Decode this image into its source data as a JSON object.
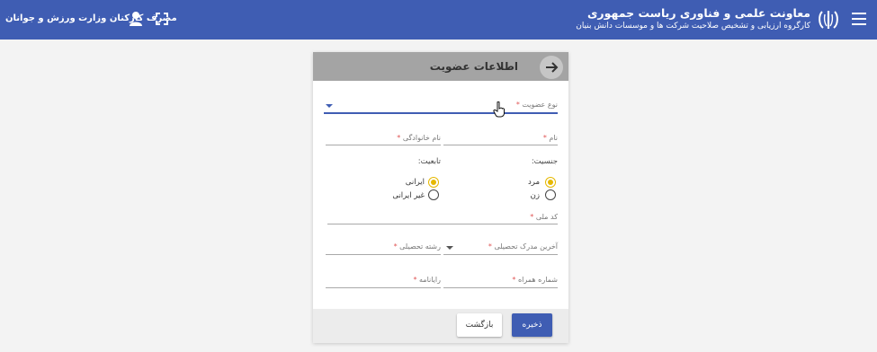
{
  "header": {
    "title": "معاونت علمی و فناوری ریاست جمهوری",
    "subtitle": "کارگروه ارزیابی و تشخیص صلاحیت شرکت ها و موسسات دانش بنیان",
    "user_name": "مصرف کارکنان وزارت ورزش و جوانان",
    "icons": [
      "menu-icon",
      "emblem-logo",
      "user-icon",
      "fullscreen-icon"
    ],
    "colors": {
      "primary": "#3f5db3"
    }
  },
  "form": {
    "title": "اطلاعات عضویت",
    "membership_type": {
      "label": "نوع عضویت"
    },
    "first_name": {
      "label": "نام"
    },
    "last_name": {
      "label": "نام خانوادگی"
    },
    "gender": {
      "label": "جنسیت:",
      "options": [
        {
          "label": "مرد",
          "selected": true
        },
        {
          "label": "زن",
          "selected": false
        }
      ]
    },
    "nationality": {
      "label": "تابعیت:",
      "options": [
        {
          "label": "ایرانی",
          "selected": true
        },
        {
          "label": "غیر ایرانی",
          "selected": false
        }
      ]
    },
    "national_code": {
      "label": "کد ملی"
    },
    "education_degree": {
      "label": "آخرین مدرک تحصیلی"
    },
    "field_of_study": {
      "label": "رشته تحصیلی"
    },
    "mobile": {
      "label": "شماره همراه"
    },
    "email": {
      "label": "رایانامه"
    },
    "required_mark": "*",
    "colors": {
      "selected_radio": "#e6b800"
    }
  },
  "footer": {
    "save_label": "ذخیره",
    "back_label": "بازگشت"
  }
}
